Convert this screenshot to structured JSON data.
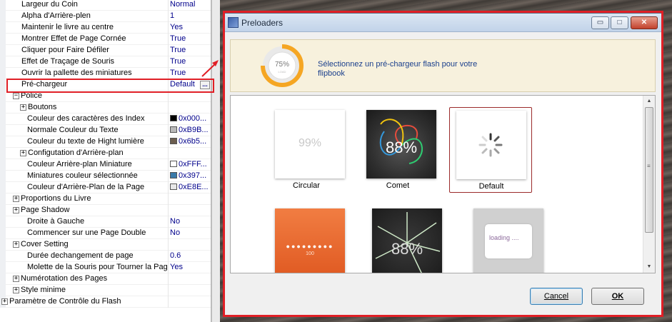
{
  "properties": {
    "rows": [
      {
        "name": "Largeur du Coin",
        "value": "Normal",
        "indent": 1
      },
      {
        "name": "Alpha d'Arrière-plen",
        "value": "1",
        "indent": 1
      },
      {
        "name": "Maintenir le livre au centre",
        "value": "Yes",
        "indent": 1
      },
      {
        "name": "Montrer Effet de Page Cornée",
        "value": "True",
        "indent": 1
      },
      {
        "name": "Cliquer pour Faire Défiler",
        "value": "True",
        "indent": 1
      },
      {
        "name": "Effet de Traçage de Souris",
        "value": "True",
        "indent": 1
      },
      {
        "name": "Ouvrir la pallette des miniatures",
        "value": "True",
        "indent": 1
      },
      {
        "name": "Pré-chargeur",
        "value": "Default",
        "indent": 1,
        "button": "..."
      },
      {
        "name": "Police",
        "value": "",
        "indent": 1,
        "expander": "−"
      },
      {
        "name": "Boutons",
        "value": "",
        "indent": 2,
        "expander": "+"
      },
      {
        "name": "Couleur des caractères des Index",
        "value": "0x000...",
        "indent": 3,
        "swatch": "#000000"
      },
      {
        "name": "Normale Couleur du Texte",
        "value": "0xB9B...",
        "indent": 3,
        "swatch": "#b9b9b9"
      },
      {
        "name": "Couleur du texte de Hight lumière",
        "value": "0x6b5...",
        "indent": 3,
        "swatch": "#6b5d4f"
      },
      {
        "name": "Configutation d'Arrière-plan",
        "value": "",
        "indent": 2,
        "expander": "+"
      },
      {
        "name": "Couleur Arrière-plan Miniature",
        "value": "0xFFF...",
        "indent": 2,
        "swatch": "#ffffff"
      },
      {
        "name": "Miniatures couleur sélectionnée",
        "value": "0x397...",
        "indent": 2,
        "swatch": "#3979a8"
      },
      {
        "name": "Couleur d'Arrière-Plan de la Page",
        "value": "0xE8E...",
        "indent": 2,
        "swatch": "#e8e8e8"
      },
      {
        "name": "Proportions du Livre",
        "value": "",
        "indent": 1,
        "expander": "+"
      },
      {
        "name": "Page Shadow",
        "value": "",
        "indent": 1,
        "expander": "+"
      },
      {
        "name": "Droite à Gauche",
        "value": "No",
        "indent": 2
      },
      {
        "name": "Commencer sur une Page Double",
        "value": "No",
        "indent": 2
      },
      {
        "name": "Cover Setting",
        "value": "",
        "indent": 1,
        "expander": "+"
      },
      {
        "name": "Durée dechangement de page",
        "value": "0.6",
        "indent": 2
      },
      {
        "name": "Molette de la Souris pour Tourner la Page",
        "value": "Yes",
        "indent": 2
      },
      {
        "name": "Numérotation des Pages",
        "value": "",
        "indent": 1,
        "expander": "+"
      },
      {
        "name": "Style minime",
        "value": "",
        "indent": 1,
        "expander": "+"
      },
      {
        "name": "Paramètre de Contrôle du Flash",
        "value": "",
        "indent": 0,
        "expander": "+"
      }
    ]
  },
  "dialog": {
    "title": "Preloaders",
    "window_buttons": {
      "minimize": "▭",
      "maximize": "□",
      "close": "✕"
    },
    "banner": {
      "gauge_percent": "75%",
      "gauge_sub": "LOAD",
      "text": "Sélectionnez un pré-chargeur flash pour votre flipbook"
    },
    "preloaders": [
      {
        "label": "Circular",
        "preview_text": "99%",
        "selected": false
      },
      {
        "label": "Comet",
        "preview_text": "88%",
        "selected": false
      },
      {
        "label": "Default",
        "preview_text": "",
        "selected": true
      },
      {
        "label": "",
        "preview_text": "●●●●●●●●●",
        "preview_sub": "100",
        "selected": false
      },
      {
        "label": "",
        "preview_text": "88%",
        "selected": false
      },
      {
        "label": "",
        "preview_text": "loading ....",
        "selected": false
      }
    ],
    "buttons": {
      "cancel": "Cancel",
      "ok": "OK"
    }
  },
  "colors": {
    "highlight": "#e01f26",
    "value_text": "#00008b",
    "banner_text": "#1a3f8c"
  }
}
